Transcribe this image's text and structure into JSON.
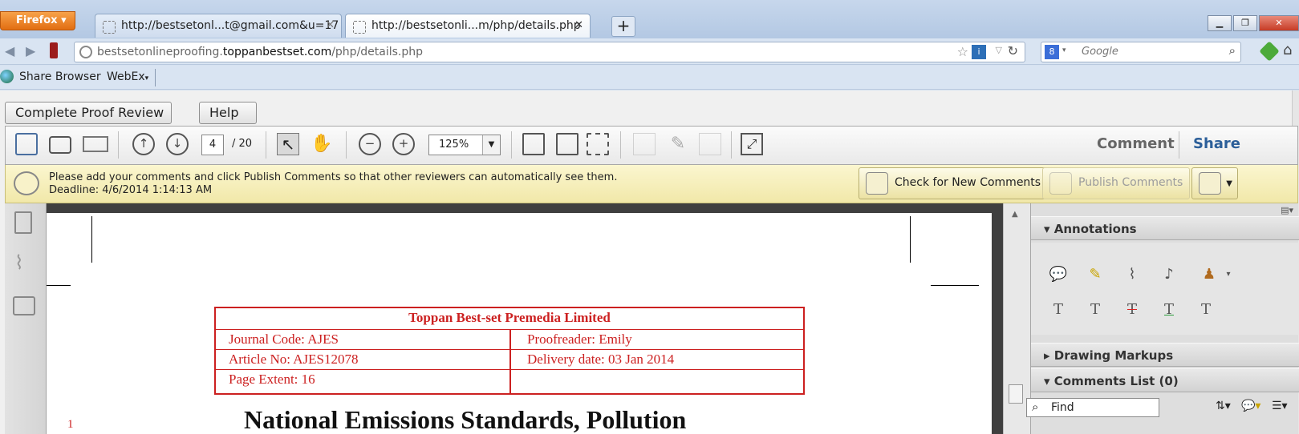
{
  "browser": {
    "menu_label": "Firefox",
    "tabs": [
      {
        "title": "http://bestsetonl...t@gmail.com&u=17",
        "active": false
      },
      {
        "title": "http://bestsetonli...m/php/details.php",
        "active": true
      }
    ],
    "new_tab_label": "+",
    "address": {
      "prefix": "bestsetonlineproofing.",
      "domain": "toppanbestset.com",
      "path": "/php/details.php"
    },
    "search_placeholder": "Google",
    "bookmarks": [
      "Share Browser",
      "WebEx"
    ]
  },
  "page_buttons": {
    "complete_review": "Complete Proof Review",
    "help": "Help"
  },
  "acrobat": {
    "current_page": "4",
    "page_count": "/ 20",
    "zoom": "125%",
    "comment_tab": "Comment",
    "share_tab": "Share"
  },
  "comment_bar": {
    "message": "Please add your comments and click Publish Comments so that other reviewers can automatically see them.",
    "deadline": "Deadline: 4/6/2014 1:14:13 AM",
    "check_button": "Check for New Comments",
    "publish_button": "Publish Comments"
  },
  "panel": {
    "annotations": "Annotations",
    "drawing_markups": "Drawing Markups",
    "comments_list": "Comments List (0)",
    "find_placeholder": "Find"
  },
  "document": {
    "publisher": "Toppan Best-set Premedia Limited",
    "journal_code": "Journal Code: AJES",
    "proofreader": "Proofreader: Emily",
    "article_no": "Article No: AJES12078",
    "delivery_date": "Delivery date: 03 Jan 2014",
    "page_extent": "Page Extent: 16",
    "title": "National Emissions Standards, Pollution",
    "line_number": "1"
  }
}
